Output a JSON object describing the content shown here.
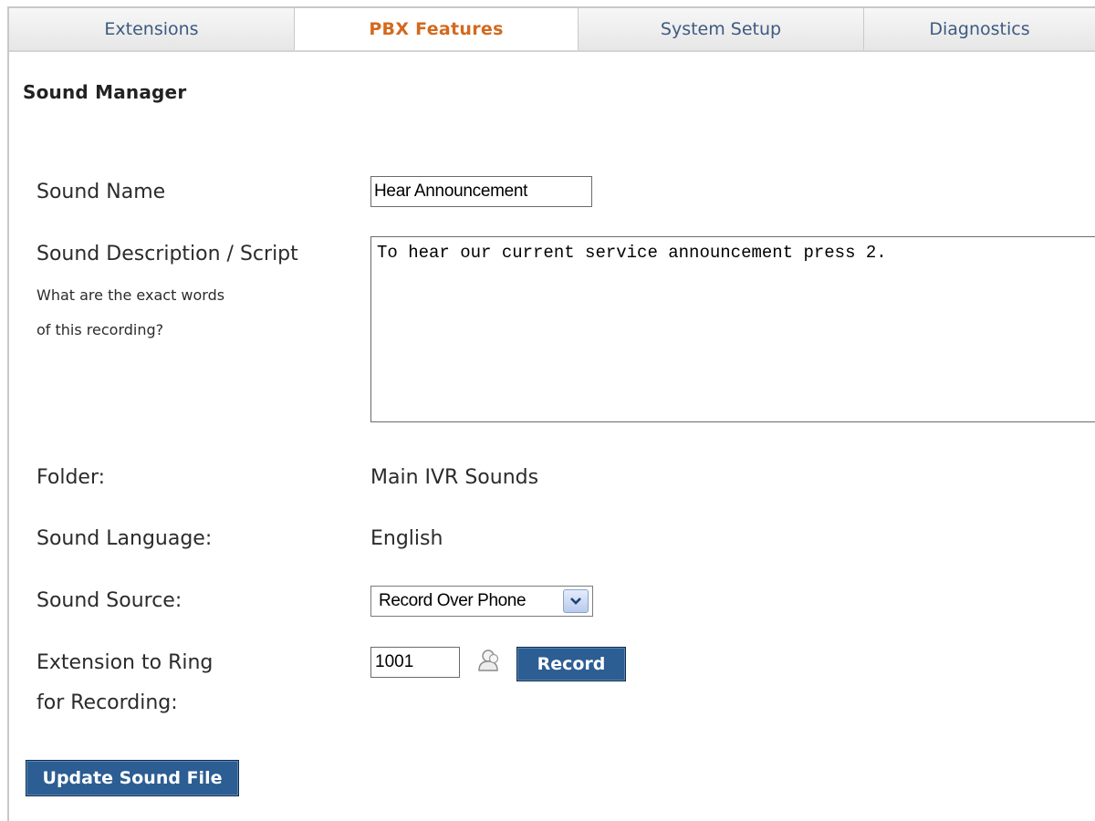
{
  "tabs": [
    {
      "label": "Extensions",
      "active": false
    },
    {
      "label": "PBX Features",
      "active": true
    },
    {
      "label": "System Setup",
      "active": false
    },
    {
      "label": "Diagnostics",
      "active": false
    }
  ],
  "page_title": "Sound Manager",
  "form": {
    "sound_name": {
      "label": "Sound Name",
      "value": "Hear Announcement"
    },
    "description": {
      "label": "Sound Description / Script",
      "hint_line1": "What are the exact words",
      "hint_line2": "of this recording?",
      "value": "To hear our current service announcement press 2."
    },
    "folder": {
      "label": "Folder:",
      "value": "Main IVR Sounds"
    },
    "language": {
      "label": "Sound Language:",
      "value": "English"
    },
    "source": {
      "label": "Sound Source:",
      "selected": "Record Over Phone"
    },
    "extension": {
      "label_line1": "Extension to Ring",
      "label_line2": "for Recording:",
      "value": "1001",
      "record_label": "Record"
    }
  },
  "update_button_label": "Update Sound File",
  "colors": {
    "active_tab": "#d4691e",
    "tab_text": "#3d5a80",
    "button_bg": "#2c5d93"
  },
  "icons": [
    "user-lookup-icon",
    "chevron-down-icon"
  ]
}
